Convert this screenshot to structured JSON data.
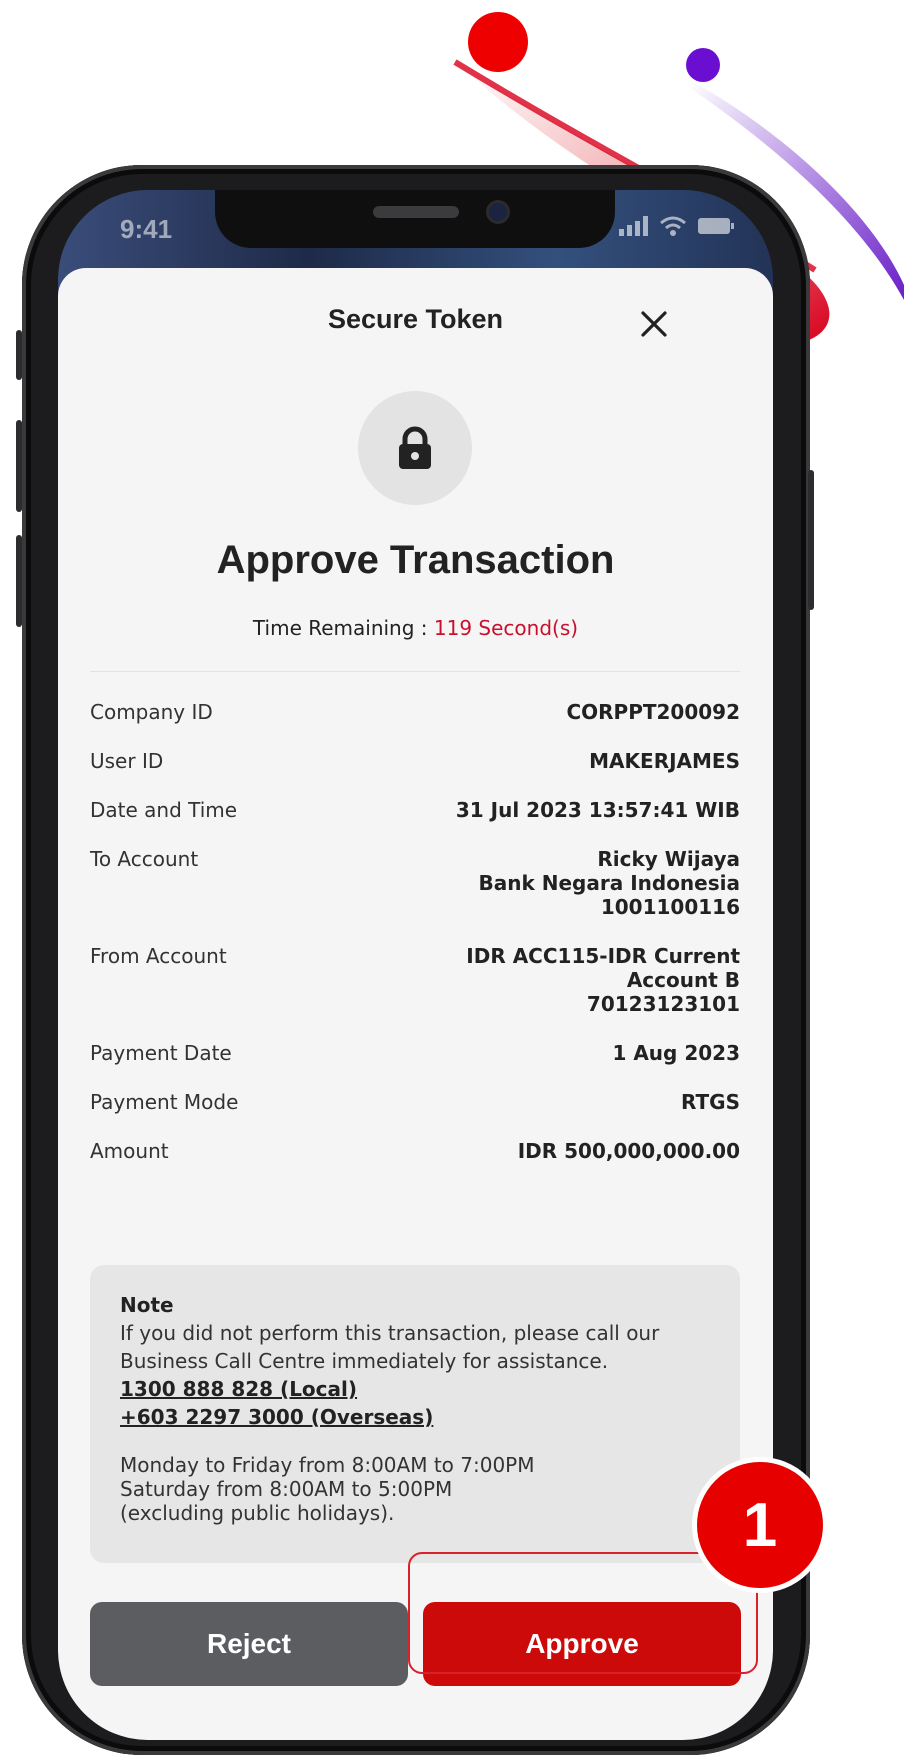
{
  "status_bar": {
    "time": "9:41"
  },
  "sheet": {
    "title": "Secure Token",
    "heading": "Approve Transaction",
    "timer": {
      "label": "Time Remaining :",
      "value": "119 Second(s)"
    },
    "details": [
      {
        "label": "Company ID",
        "value": "CORPPT200092"
      },
      {
        "label": "User ID",
        "value": "MAKERJAMES"
      },
      {
        "label": "Date and Time",
        "value": "31 Jul 2023 13:57:41 WIB"
      },
      {
        "label": "To Account",
        "value_lines": [
          "Ricky Wijaya",
          "Bank Negara Indonesia",
          "1001100116"
        ]
      },
      {
        "label": "From Account",
        "value_lines": [
          "IDR ACC115-IDR Current",
          "Account B",
          "70123123101"
        ]
      },
      {
        "label": "Payment Date",
        "value": "1 Aug 2023"
      },
      {
        "label": "Payment Mode",
        "value": "RTGS"
      },
      {
        "label": "Amount",
        "value": "IDR 500,000,000.00"
      }
    ],
    "note": {
      "heading": "Note",
      "body_line1": "If you did not perform this transaction, please call our",
      "body_line2": "Business Call Centre immediately for assistance.",
      "phone_local": "1300 888 828 (Local)",
      "phone_overseas": "+603 2297 3000 (Overseas)",
      "hours_line1": "Monday to Friday from 8:00AM to 7:00PM",
      "hours_line2": "Saturday from 8:00AM to 5:00PM",
      "hours_line3": "(excluding public holidays)."
    },
    "buttons": {
      "reject": "Reject",
      "approve": "Approve"
    }
  },
  "annotation": {
    "step_number": "1"
  },
  "colors": {
    "accent_red": "#cc0a0a",
    "timer_red": "#c8102e",
    "reject_gray": "#5b5d60",
    "badge_red": "#e60000",
    "swoosh_purple": "#6a1fc9"
  },
  "icons": [
    "close-icon",
    "lock-icon",
    "signal-icon",
    "wifi-icon",
    "battery-icon"
  ]
}
